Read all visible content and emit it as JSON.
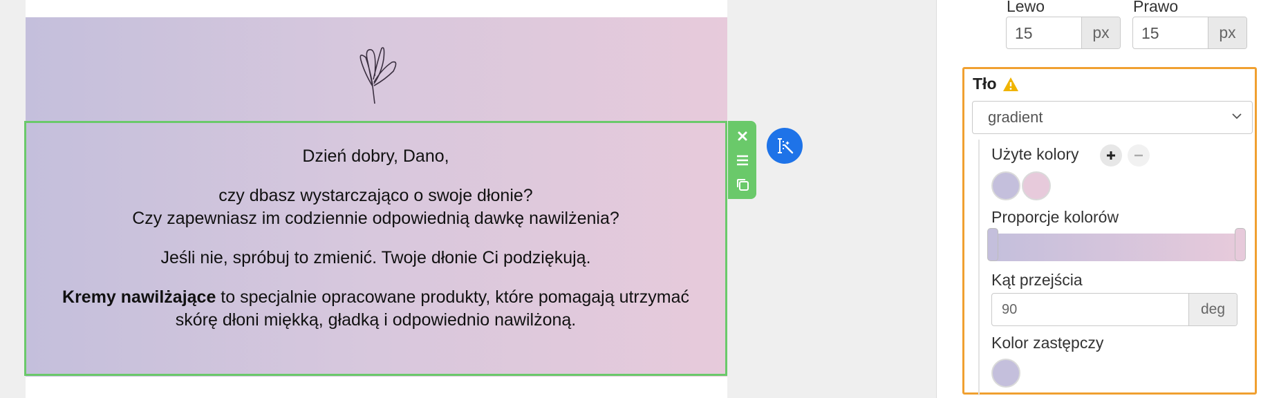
{
  "email": {
    "greeting": "Dzień dobry, Dano,",
    "line1": "czy dbasz wystarczająco o swoje dłonie?",
    "line2": "Czy zapewniasz im codziennie odpowiednią dawkę nawilżenia?",
    "line3": "Jeśli nie, spróbuj to zmienić. Twoje dłonie Ci podziękują.",
    "bold": "Kremy nawilżające",
    "line4_rest": " to specjalnie opracowane produkty, które pomagają utrzymać",
    "line5": "skórę dłoni miękką, gładką i odpowiednio nawilżoną."
  },
  "toolbar": {
    "icons": [
      "close-icon",
      "drag-handle-icon",
      "duplicate-icon"
    ],
    "magic_icon": "text-magic-icon"
  },
  "panel": {
    "padding": {
      "left_label": "Lewo",
      "left_value": "15",
      "right_label": "Prawo",
      "right_value": "15",
      "unit": "px"
    },
    "background": {
      "title": "Tło",
      "type": "gradient",
      "colors_label": "Użyte kolory",
      "colors": [
        "#c4bfdc",
        "#e7cadb"
      ],
      "proportions_label": "Proporcje kolorów",
      "proportions": [
        0,
        100
      ],
      "angle_label": "Kąt przejścia",
      "angle": "90",
      "angle_unit": "deg",
      "fallback_label": "Kolor zastępczy",
      "fallback_color": "#c4bfdc",
      "warning_color": "#f0b400"
    }
  },
  "colors": {
    "selection_green": "#6ac96a",
    "accent_blue": "#1e73e8",
    "highlight_orange": "#f0a030"
  }
}
